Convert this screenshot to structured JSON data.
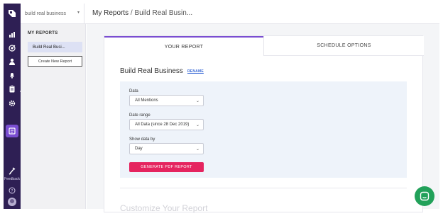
{
  "rail": {
    "icons": [
      "logo-icon",
      "bar-chart-icon",
      "radar-icon",
      "user-icon",
      "bell-icon",
      "clipboard-icon",
      "gear-icon",
      "reports-icon",
      "feedback-icon",
      "help-icon",
      "avatar"
    ],
    "feedback_label": "Feedback",
    "accent": "#7a4ed1",
    "background": "#2e1f54"
  },
  "header": {
    "workspace": "build real business",
    "breadcrumb_root": "My Reports",
    "breadcrumb_sep": "/",
    "breadcrumb_current": "Build Real Busin..."
  },
  "sidebar": {
    "heading": "MY REPORTS",
    "selected_report": "Build Real Busi...",
    "create_button": "Create New Report"
  },
  "tabs": [
    {
      "label": "YOUR REPORT",
      "active": true
    },
    {
      "label": "SCHEDULE OPTIONS",
      "active": false
    }
  ],
  "report": {
    "title": "Build Real Business",
    "rename": "RENAME"
  },
  "form": {
    "data_label": "Data",
    "data_value": "All Mentions",
    "range_label": "Date range",
    "range_value": "All Data (since 28 Dec 2019)",
    "group_label": "Show data by",
    "group_value": "Day",
    "generate_button": "GENERATE PDF REPORT",
    "button_color": "#e5245f"
  },
  "below": {
    "faded_title": "Customize Your Report"
  },
  "chat": {
    "color": "#22a15a"
  }
}
